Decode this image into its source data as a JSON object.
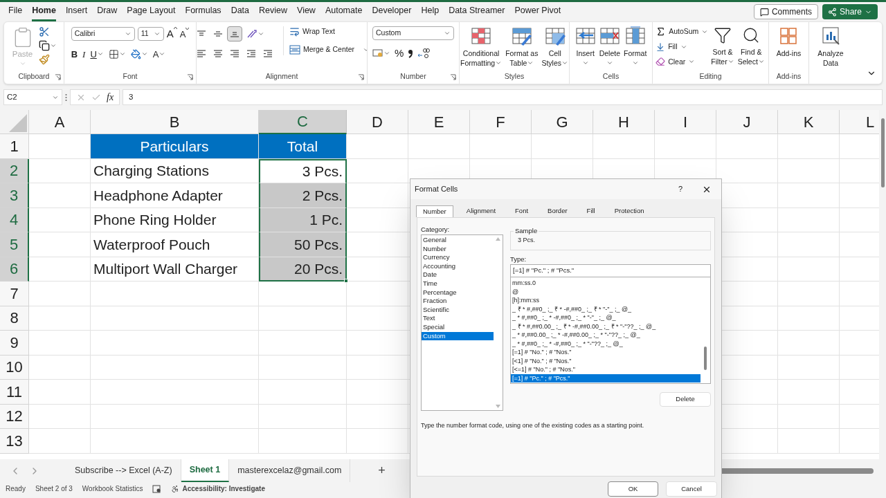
{
  "menu_tabs": [
    {
      "label": "File",
      "selected": false
    },
    {
      "label": "Home",
      "selected": true
    },
    {
      "label": "Insert",
      "selected": false
    },
    {
      "label": "Draw",
      "selected": false
    },
    {
      "label": "Page Layout",
      "selected": false
    },
    {
      "label": "Formulas",
      "selected": false
    },
    {
      "label": "Data",
      "selected": false
    },
    {
      "label": "Review",
      "selected": false
    },
    {
      "label": "View",
      "selected": false
    },
    {
      "label": "Automate",
      "selected": false
    },
    {
      "label": "Developer",
      "selected": false
    },
    {
      "label": "Help",
      "selected": false
    },
    {
      "label": "Data Streamer",
      "selected": false
    },
    {
      "label": "Power Pivot",
      "selected": false
    }
  ],
  "top_buttons": {
    "comments": "Comments",
    "share": "Share"
  },
  "ribbon": {
    "clipboard": {
      "paste": "Paste",
      "paste_disabled": true,
      "label": "Clipboard"
    },
    "font": {
      "family": "Calibri",
      "size": "11",
      "grow": "A",
      "shrink": "A",
      "bold": "B",
      "italic": "I",
      "underline": "U",
      "font_color_letter": "A",
      "label": "Font"
    },
    "alignment": {
      "vertical": [
        {
          "selected": false
        },
        {
          "selected": false
        },
        {
          "selected": true
        }
      ],
      "wrap": "Wrap Text",
      "merge": "Merge & Center",
      "label": "Alignment"
    },
    "number": {
      "format": "Custom",
      "percent": "%",
      "label": "Number"
    },
    "styles": {
      "buttons": [
        {
          "lines": [
            "Conditional",
            "Formatting"
          ],
          "kind": "conditional"
        },
        {
          "lines": [
            "Format as",
            "Table"
          ],
          "kind": "table"
        },
        {
          "lines": [
            "Cell",
            "Styles"
          ],
          "kind": "cell"
        }
      ],
      "label": "Styles"
    },
    "cells": {
      "buttons": [
        {
          "label": "Insert",
          "kind": "insert"
        },
        {
          "label": "Delete",
          "kind": "delete"
        },
        {
          "label": "Format",
          "kind": "format"
        }
      ],
      "label": "Cells"
    },
    "editing": {
      "autosum": "AutoSum",
      "fill": "Fill",
      "clear": "Clear",
      "sort": [
        "Sort &",
        "Filter"
      ],
      "find": [
        "Find &",
        "Select"
      ],
      "label": "Editing"
    },
    "addins": {
      "button": "Add-ins",
      "label": "Add-ins"
    },
    "analyze": {
      "lines": [
        "Analyze",
        "Data"
      ]
    }
  },
  "formula_bar": {
    "name_box": "C2",
    "fx": "fx",
    "value": "3"
  },
  "table": {
    "columns": [
      {
        "label": "A",
        "selected": false
      },
      {
        "label": "B",
        "selected": false
      },
      {
        "label": "C",
        "selected": true
      },
      {
        "label": "D",
        "selected": false
      },
      {
        "label": "E",
        "selected": false
      },
      {
        "label": "F",
        "selected": false
      },
      {
        "label": "G",
        "selected": false
      },
      {
        "label": "H",
        "selected": false
      },
      {
        "label": "I",
        "selected": false
      },
      {
        "label": "J",
        "selected": false
      },
      {
        "label": "K",
        "selected": false
      },
      {
        "label": "L",
        "selected": false
      }
    ],
    "rows": [
      {
        "header": "1",
        "selected": false,
        "kind": "heading",
        "b": "Particulars",
        "c": "Total"
      },
      {
        "header": "2",
        "selected": true,
        "kind": "data",
        "b": "Charging Stations",
        "c": "3 Pcs.",
        "c_selected": true,
        "c_active": true
      },
      {
        "header": "3",
        "selected": true,
        "kind": "data",
        "b": "Headphone Adapter",
        "c": "2 Pcs.",
        "c_selected": true,
        "c_active": false
      },
      {
        "header": "4",
        "selected": true,
        "kind": "data",
        "b": "Phone Ring Holder",
        "c": "1 Pc.",
        "c_selected": true,
        "c_active": false
      },
      {
        "header": "5",
        "selected": true,
        "kind": "data",
        "b": "Waterproof Pouch",
        "c": "50 Pcs.",
        "c_selected": true,
        "c_active": false
      },
      {
        "header": "6",
        "selected": true,
        "kind": "data",
        "b": "Multiport Wall Charger",
        "c": "20 Pcs.",
        "c_selected": true,
        "c_active": false
      },
      {
        "header": "7",
        "selected": false,
        "kind": "empty"
      },
      {
        "header": "8",
        "selected": false,
        "kind": "empty"
      },
      {
        "header": "9",
        "selected": false,
        "kind": "empty"
      },
      {
        "header": "10",
        "selected": false,
        "kind": "empty"
      },
      {
        "header": "11",
        "selected": false,
        "kind": "empty"
      },
      {
        "header": "12",
        "selected": false,
        "kind": "empty"
      },
      {
        "header": "13",
        "selected": false,
        "kind": "empty"
      }
    ]
  },
  "sheet_tabs": [
    {
      "label": "Subscribe --> Excel (A-Z)",
      "selected": false
    },
    {
      "label": "Sheet 1",
      "selected": true
    },
    {
      "label": "masterexcelaz@gmail.com",
      "selected": false
    }
  ],
  "add_sheet": "+",
  "status_bar": {
    "ready": "Ready",
    "sheet": "Sheet 2 of 3",
    "stats": "Workbook Statistics",
    "accessibility": "Accessibility: Investigate"
  },
  "dialog": {
    "title": "Format Cells",
    "help": "?",
    "tabs": [
      {
        "label": "Number",
        "selected": true
      },
      {
        "label": "Alignment",
        "selected": false
      },
      {
        "label": "Font",
        "selected": false
      },
      {
        "label": "Border",
        "selected": false
      },
      {
        "label": "Fill",
        "selected": false
      },
      {
        "label": "Protection",
        "selected": false
      }
    ],
    "category_label": "Category:",
    "categories": [
      {
        "label": "General",
        "selected": false
      },
      {
        "label": "Number",
        "selected": false
      },
      {
        "label": "Currency",
        "selected": false
      },
      {
        "label": "Accounting",
        "selected": false
      },
      {
        "label": "Date",
        "selected": false
      },
      {
        "label": "Time",
        "selected": false
      },
      {
        "label": "Percentage",
        "selected": false
      },
      {
        "label": "Fraction",
        "selected": false
      },
      {
        "label": "Scientific",
        "selected": false
      },
      {
        "label": "Text",
        "selected": false
      },
      {
        "label": "Special",
        "selected": false
      },
      {
        "label": "Custom",
        "selected": true
      }
    ],
    "sample_label": "Sample",
    "sample": "3 Pcs.",
    "type_label": "Type:",
    "type_value": "[=1] # \"Pc.\" ; # \"Pcs.\"",
    "formats": [
      {
        "label": "mm:ss.0",
        "selected": false
      },
      {
        "label": "@",
        "selected": false
      },
      {
        "label": "[h]:mm:ss",
        "selected": false
      },
      {
        "label": "_ ₹ * #,##0_ ;_ ₹ * -#,##0_ ;_ ₹ * \"-\"_ ;_ @_",
        "selected": false
      },
      {
        "label": "_ * #,##0_ ;_ * -#,##0_ ;_ * \"-\"_ ;_ @_",
        "selected": false
      },
      {
        "label": "_ ₹ * #,##0.00_ ;_ ₹ * -#,##0.00_ ;_ ₹ * \"-\"??_ ;_ @_",
        "selected": false
      },
      {
        "label": "_ * #,##0.00_ ;_ * -#,##0.00_ ;_ * \"-\"??_ ;_ @_",
        "selected": false
      },
      {
        "label": "_ * #,##0_ ;_ * -#,##0_ ;_ * \"-\"??_ ;_ @_",
        "selected": false
      },
      {
        "label": "[=1] # \"No.\" ; # \"Nos.\"",
        "selected": false
      },
      {
        "label": "[<1] # \"No.\" ; # \"Nos.\"",
        "selected": false
      },
      {
        "label": "[<=1] # \"No.\" ; # \"Nos.\"",
        "selected": false
      },
      {
        "label": "[=1] # \"Pc.\" ; # \"Pcs.\"",
        "selected": true
      }
    ],
    "delete": "Delete",
    "hint": "Type the number format code, using one of the existing codes as a starting point.",
    "ok": "OK",
    "cancel": "Cancel"
  }
}
